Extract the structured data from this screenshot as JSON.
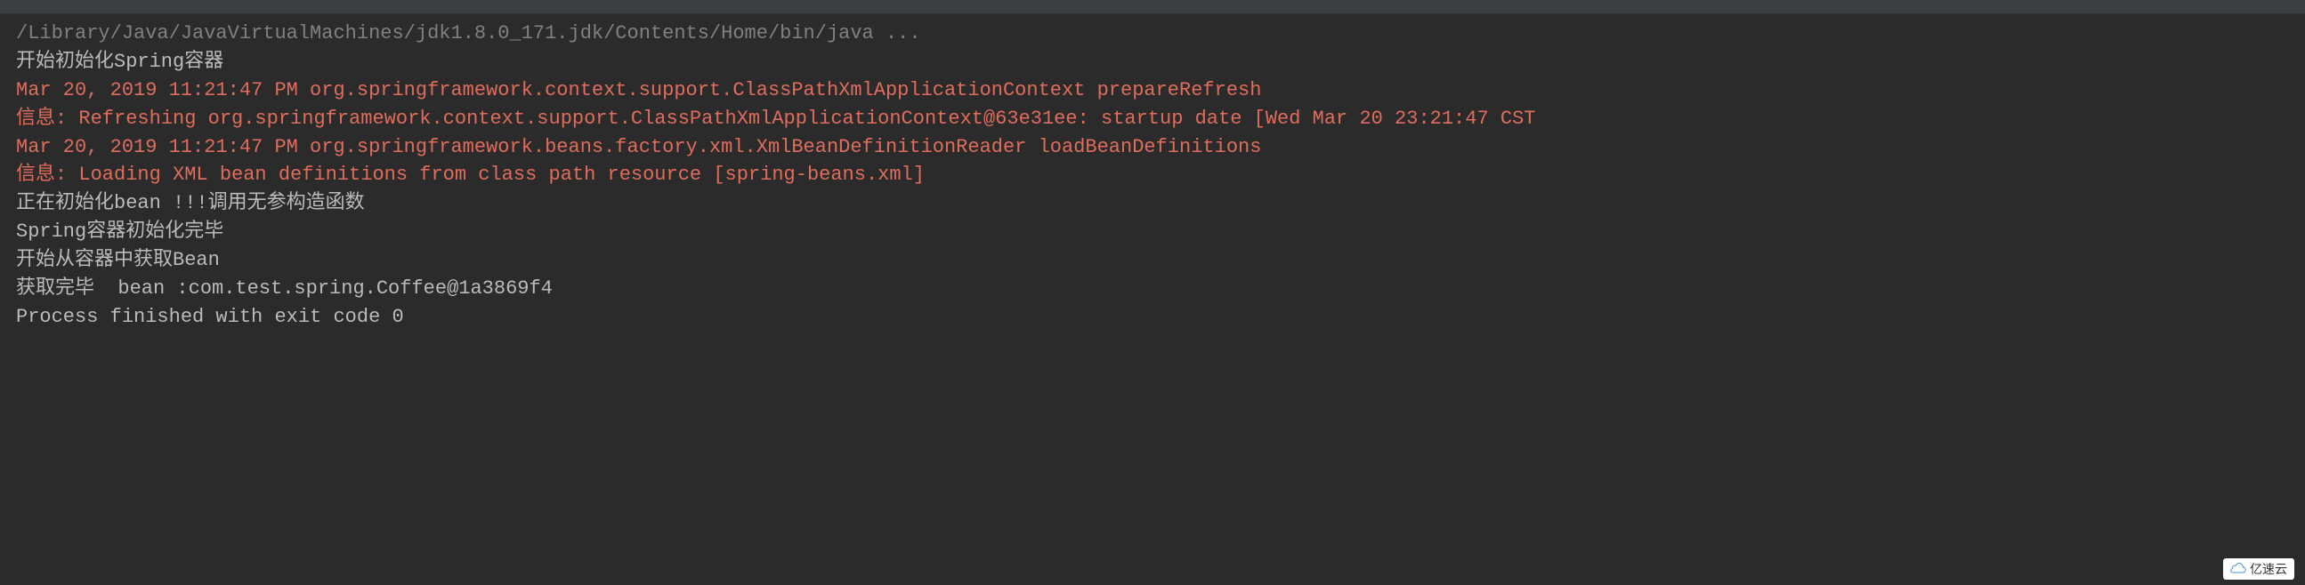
{
  "console": {
    "lines": [
      {
        "cls": "cmd",
        "text": "/Library/Java/JavaVirtualMachines/jdk1.8.0_171.jdk/Contents/Home/bin/java ..."
      },
      {
        "cls": "normal",
        "text": "开始初始化Spring容器"
      },
      {
        "cls": "err",
        "text": "Mar 20, 2019 11:21:47 PM org.springframework.context.support.ClassPathXmlApplicationContext prepareRefresh"
      },
      {
        "cls": "err",
        "text": "信息: Refreshing org.springframework.context.support.ClassPathXmlApplicationContext@63e31ee: startup date [Wed Mar 20 23:21:47 CST"
      },
      {
        "cls": "err",
        "text": "Mar 20, 2019 11:21:47 PM org.springframework.beans.factory.xml.XmlBeanDefinitionReader loadBeanDefinitions"
      },
      {
        "cls": "err",
        "text": "信息: Loading XML bean definitions from class path resource [spring-beans.xml]"
      },
      {
        "cls": "normal",
        "text": "正在初始化bean !!!调用无参构造函数"
      },
      {
        "cls": "normal",
        "text": "Spring容器初始化完毕"
      },
      {
        "cls": "normal",
        "text": "开始从容器中获取Bean"
      },
      {
        "cls": "normal",
        "text": "获取完毕  bean :com.test.spring.Coffee@1a3869f4"
      },
      {
        "cls": "normal",
        "text": ""
      },
      {
        "cls": "normal",
        "text": "Process finished with exit code 0"
      }
    ]
  },
  "watermark": {
    "label": "亿速云"
  }
}
